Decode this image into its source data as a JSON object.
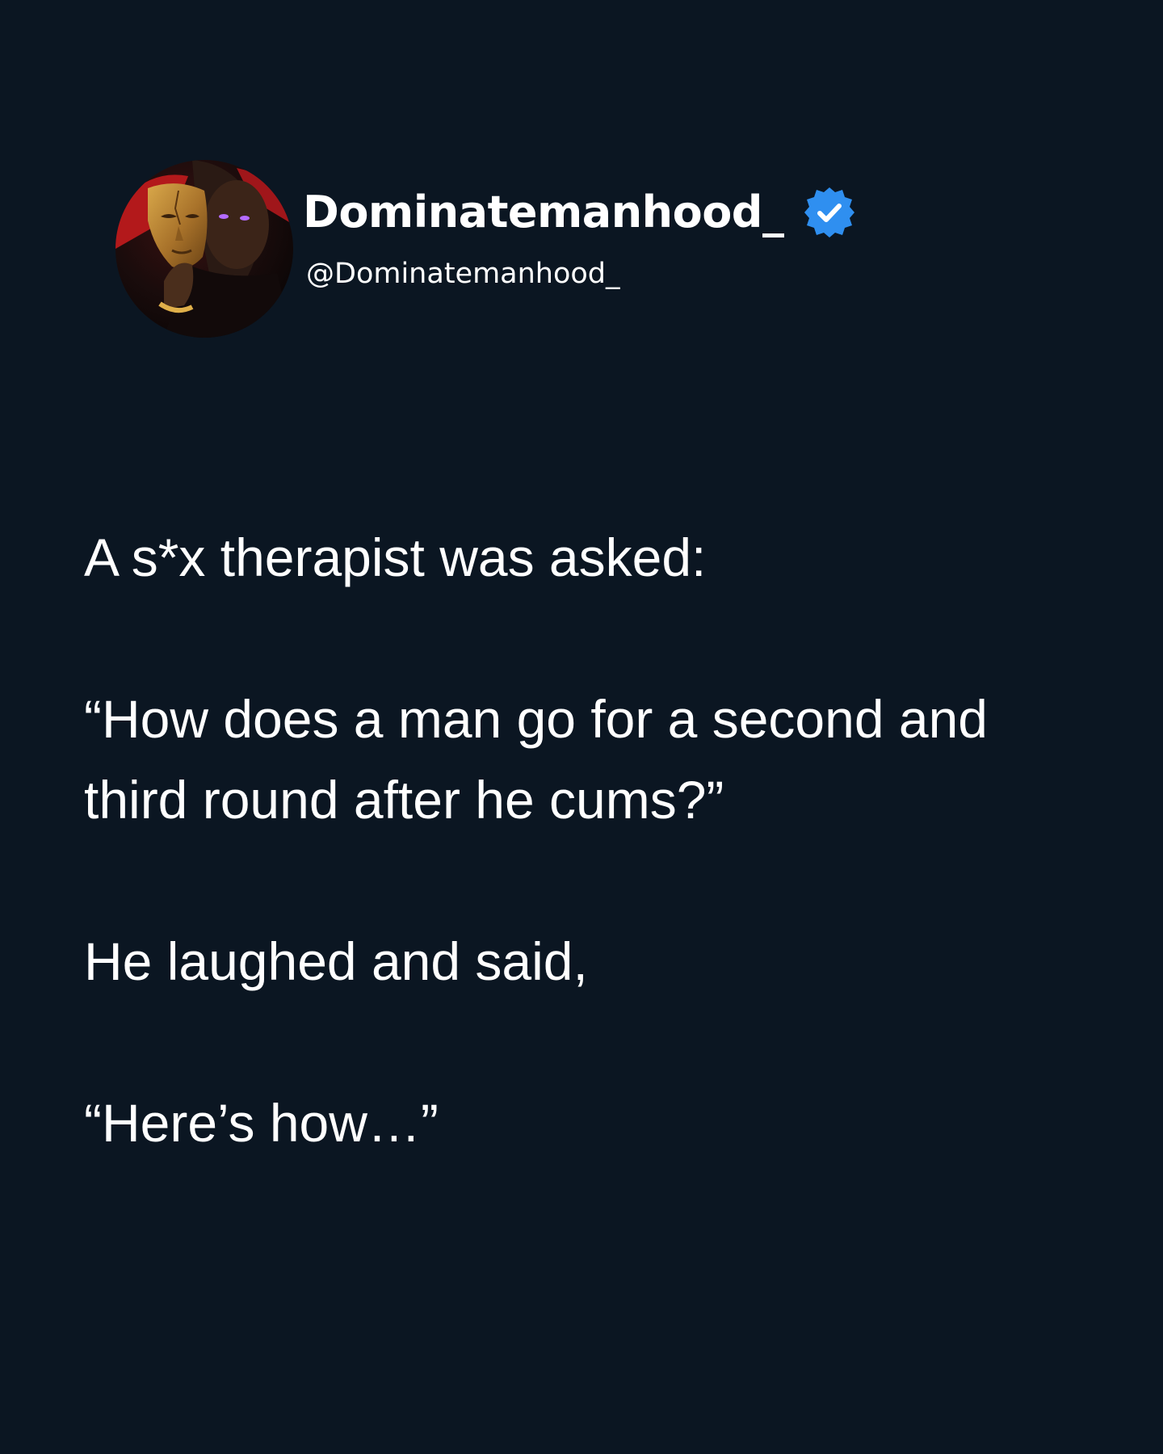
{
  "profile": {
    "display_name": "Dominatemanhood_",
    "handle": "@Dominatemanhood_",
    "verified": true,
    "verified_color": "#2f8ff0"
  },
  "post": {
    "paragraphs": [
      "A s*x therapist was asked:",
      "“How does a man go for a second and third round after he cums?”",
      "He laughed and said,",
      "“Here’s how…”"
    ]
  },
  "colors": {
    "background": "#0b1622",
    "text": "#ffffff"
  }
}
